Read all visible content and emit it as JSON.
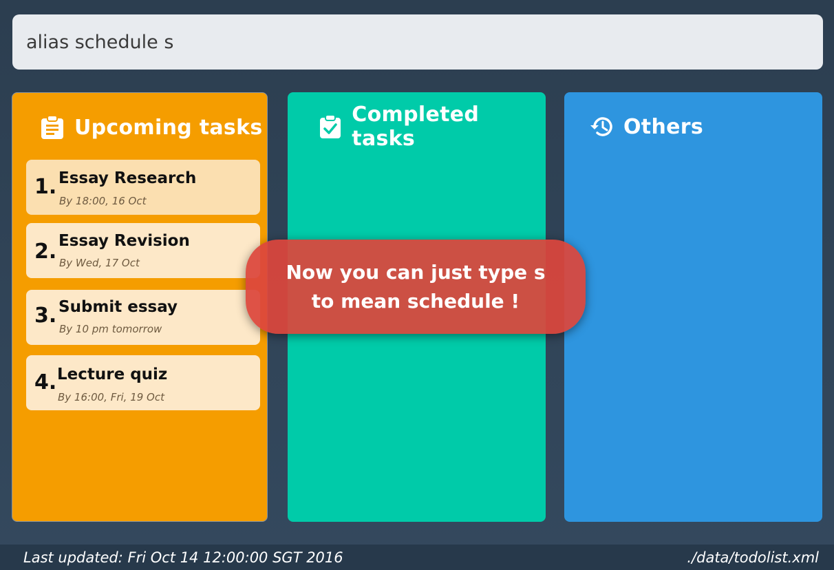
{
  "command": {
    "value": "alias schedule s"
  },
  "panels": {
    "upcoming": {
      "title": "Upcoming tasks",
      "icon": "clipboard-list-icon",
      "color": "#f59d00",
      "tasks": [
        {
          "index": "1.",
          "title": "Essay Research",
          "due": "By 18:00, 16 Oct"
        },
        {
          "index": "2.",
          "title": "Essay Revision",
          "due": "By Wed, 17 Oct"
        },
        {
          "index": "3.",
          "title": "Submit essay",
          "due": "By 10 pm tomorrow"
        },
        {
          "index": "4.",
          "title": "Lecture quiz",
          "due": "By 16:00, Fri, 19 Oct"
        }
      ]
    },
    "completed": {
      "title": "Completed tasks",
      "icon": "clipboard-check-icon",
      "color": "#00cba9"
    },
    "others": {
      "title": "Others",
      "icon": "history-icon",
      "color": "#2e95df"
    }
  },
  "tooltip": {
    "line1": "Now you can just type s",
    "line2": "to mean schedule !"
  },
  "status": {
    "last_updated": "Last updated: Fri Oct 14 12:00:00 SGT 2016",
    "file_path": "./data/todolist.xml"
  }
}
